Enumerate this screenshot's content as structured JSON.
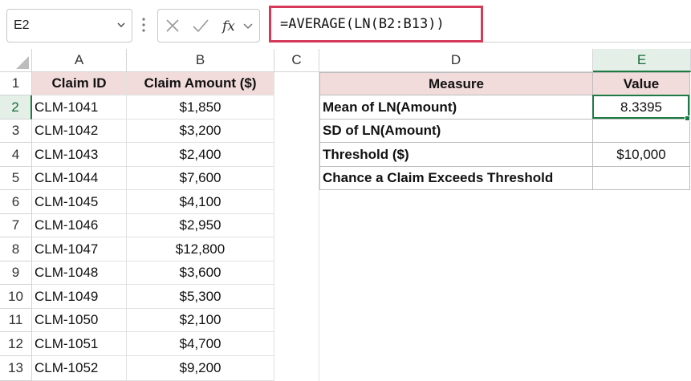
{
  "name_box": "E2",
  "formula": "=AVERAGE(LN(B2:B13))",
  "columns": [
    "A",
    "B",
    "C",
    "D",
    "E"
  ],
  "rows": [
    "1",
    "2",
    "3",
    "4",
    "5",
    "6",
    "7",
    "8",
    "9",
    "10",
    "11",
    "12",
    "13"
  ],
  "table1": {
    "headers": [
      "Claim ID",
      "Claim Amount ($)"
    ],
    "rows": [
      [
        "CLM-1041",
        "$1,850"
      ],
      [
        "CLM-1042",
        "$3,200"
      ],
      [
        "CLM-1043",
        "$2,400"
      ],
      [
        "CLM-1044",
        "$7,600"
      ],
      [
        "CLM-1045",
        "$4,100"
      ],
      [
        "CLM-1046",
        "$2,950"
      ],
      [
        "CLM-1047",
        "$12,800"
      ],
      [
        "CLM-1048",
        "$3,600"
      ],
      [
        "CLM-1049",
        "$5,300"
      ],
      [
        "CLM-1050",
        "$2,100"
      ],
      [
        "CLM-1051",
        "$4,700"
      ],
      [
        "CLM-1052",
        "$9,200"
      ]
    ]
  },
  "table2": {
    "headers": [
      "Measure",
      "Value"
    ],
    "rows": [
      [
        "Mean of LN(Amount)",
        "8.3395"
      ],
      [
        "SD of LN(Amount)",
        ""
      ],
      [
        "Threshold ($)",
        "$10,000"
      ],
      [
        "Chance a Claim Exceeds Threshold",
        ""
      ]
    ]
  },
  "colors": {
    "accent": "#1d7a42",
    "header_fill": "#f2dcdb",
    "formula_border": "#d63a5a"
  }
}
